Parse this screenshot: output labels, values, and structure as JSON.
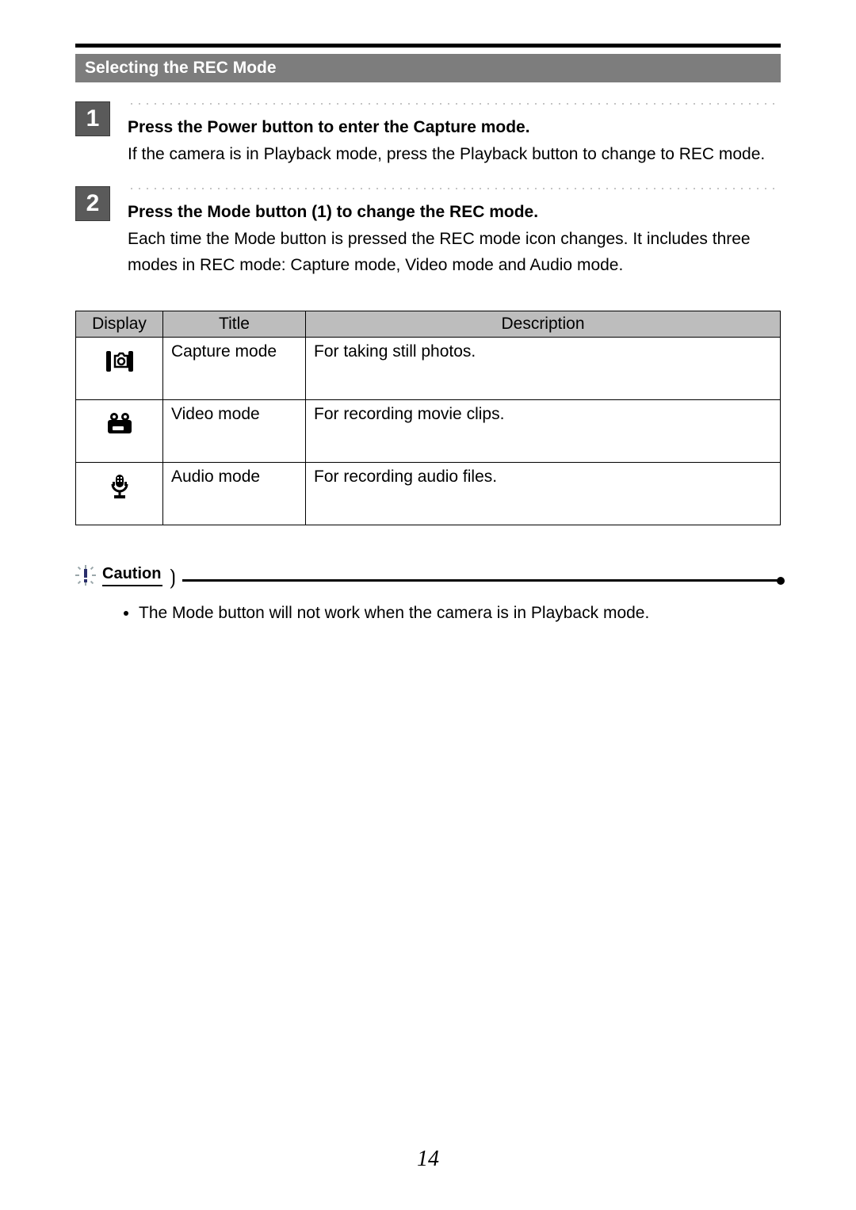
{
  "section_title": "Selecting the REC Mode",
  "steps": [
    {
      "num": "1",
      "heading": "Press the Power button to enter the Capture mode.",
      "body": "If the camera is in Playback mode, press the Playback button to change to REC mode."
    },
    {
      "num": "2",
      "heading": "Press the Mode button (1) to change the REC mode.",
      "body": "Each time the Mode button is pressed the REC mode icon changes. It includes three modes in REC mode: Capture mode, Video mode and Audio mode."
    }
  ],
  "table": {
    "headers": {
      "display": "Display",
      "title": "Title",
      "description": "Description"
    },
    "rows": [
      {
        "icon": "capture-mode-icon",
        "title": "Capture mode",
        "description": "For taking still photos."
      },
      {
        "icon": "video-mode-icon",
        "title": "Video mode",
        "description": "For recording movie clips."
      },
      {
        "icon": "audio-mode-icon",
        "title": "Audio mode",
        "description": "For recording audio files."
      }
    ]
  },
  "caution": {
    "label": "Caution",
    "items": [
      "The Mode button will not work when the camera is in Playback mode."
    ]
  },
  "page_number": "14"
}
